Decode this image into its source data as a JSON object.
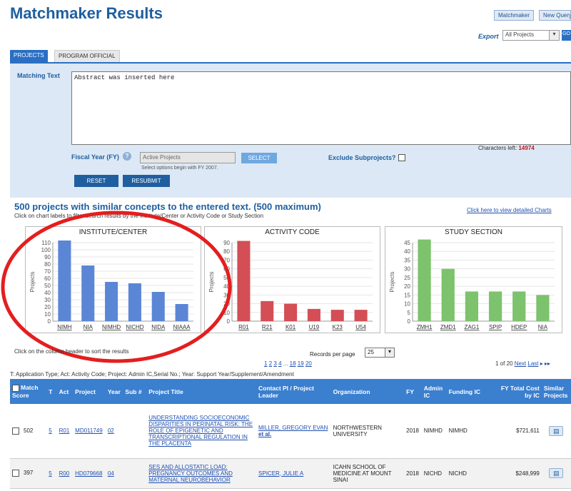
{
  "header": {
    "title": "Matchmaker Results",
    "matchmaker_btn": "Matchmaker",
    "new_query_btn": "New Query",
    "export_label": "Export",
    "export_value": "All Projects",
    "go_label": "GO"
  },
  "tabs": [
    "PROJECTS",
    "PROGRAM OFFICIAL"
  ],
  "form": {
    "matching_label": "Matching Text",
    "abstract_text": "Abstract was inserted here",
    "chars_left_label": "Characters left:",
    "chars_left_value": "14974",
    "fy_label": "Fiscal Year (FY)",
    "fy_value": "Active Projects",
    "fy_hint": "Select options begin with FY 2007.",
    "select_label": "SELECT",
    "exclude_label": "Exclude Subprojects?",
    "reset_label": "RESET",
    "resubmit_label": "RESUBMIT"
  },
  "results": {
    "heading": "500 projects with similar concepts to the entered text. (500 maximum)",
    "hint": "Click on chart labels to filter search results by the Institute/Center or Activity Code or Study Section",
    "detailed_link": "Click here to view detailed Charts"
  },
  "chart_data": [
    {
      "type": "bar",
      "title": "INSTITUTE/CENTER",
      "ylabel": "Projects",
      "categories": [
        "NIMH",
        "NIA",
        "NIMHD",
        "NICHD",
        "NIDA",
        "NIAAA"
      ],
      "values": [
        113,
        78,
        55,
        53,
        41,
        24
      ],
      "ylim": [
        0,
        110
      ],
      "yticks": [
        0,
        10,
        20,
        30,
        40,
        50,
        60,
        70,
        80,
        90,
        100,
        110
      ],
      "color": "#5b86d6"
    },
    {
      "type": "bar",
      "title": "ACTIVITY CODE",
      "ylabel": "Projects",
      "categories": [
        "R01",
        "R21",
        "K01",
        "U19",
        "K23",
        "U54"
      ],
      "values": [
        92,
        23,
        20,
        14,
        13,
        13
      ],
      "ylim": [
        0,
        90
      ],
      "yticks": [
        0,
        10,
        20,
        30,
        40,
        50,
        60,
        70,
        80,
        90
      ],
      "color": "#d44e55"
    },
    {
      "type": "bar",
      "title": "STUDY SECTION",
      "ylabel": "Projects",
      "categories": [
        "ZMH1",
        "ZMD1",
        "ZAG1",
        "SPIP",
        "HDEP",
        "NIA"
      ],
      "values": [
        49,
        30,
        17,
        17,
        17,
        15
      ],
      "ylim": [
        0,
        45
      ],
      "yticks": [
        0,
        5,
        10,
        15,
        20,
        25,
        30,
        35,
        40,
        45
      ],
      "color": "#7dc26d"
    }
  ],
  "table_controls": {
    "sort_hint": "Click on the column header to sort the results",
    "records_label": "Records per page",
    "records_value": "25",
    "pager_pages": [
      "1",
      "2",
      "3",
      "4",
      "...",
      "18",
      "19",
      "20"
    ],
    "pager_status": "1 of 20",
    "next_label": "Next",
    "last_label": "Last",
    "legend_note": "T: Application Type; Act: Activity Code; Project: Admin IC,Serial No.; Year: Support Year/Supplement/Amendment"
  },
  "table": {
    "headers": [
      "Match Score",
      "T",
      "Act",
      "Project",
      "Year",
      "Sub #",
      "Project Title",
      "Contact PI / Project Leader",
      "Organization",
      "FY",
      "Admin IC",
      "Funding IC",
      "FY Total Cost by IC",
      "Similar Projects"
    ],
    "rows": [
      {
        "score": "502",
        "t": "5",
        "act": "R01",
        "project": "MD011749",
        "year": "02",
        "sub": "",
        "title": "UNDERSTANDING SOCIOECONOMIC DISPARITIES IN PERINATAL RISK: THE ROLE OF EPIGENETIC AND TRANSCRIPTIONAL REGULATION IN THE PLACENTA",
        "pi": "MILLER, GREGORY EVAN",
        "pi_extra": "et al.",
        "org": "NORTHWESTERN UNIVERSITY",
        "fy": "2018",
        "admin_ic": "NIMHD",
        "funding_ic": "NIMHD",
        "cost": "$721,611"
      },
      {
        "score": "397",
        "t": "5",
        "act": "R00",
        "project": "HD079668",
        "year": "04",
        "sub": "",
        "title": "SES AND ALLOSTATIC LOAD: PREGNANCY OUTCOMES AND MATERNAL NEUROBEHAVIOR",
        "pi": "SPICER, JULIE A",
        "pi_extra": "",
        "org": "ICAHN SCHOOL OF MEDICINE AT MOUNT SINAI",
        "fy": "2018",
        "admin_ic": "NICHD",
        "funding_ic": "NICHD",
        "cost": "$248,999"
      }
    ]
  }
}
